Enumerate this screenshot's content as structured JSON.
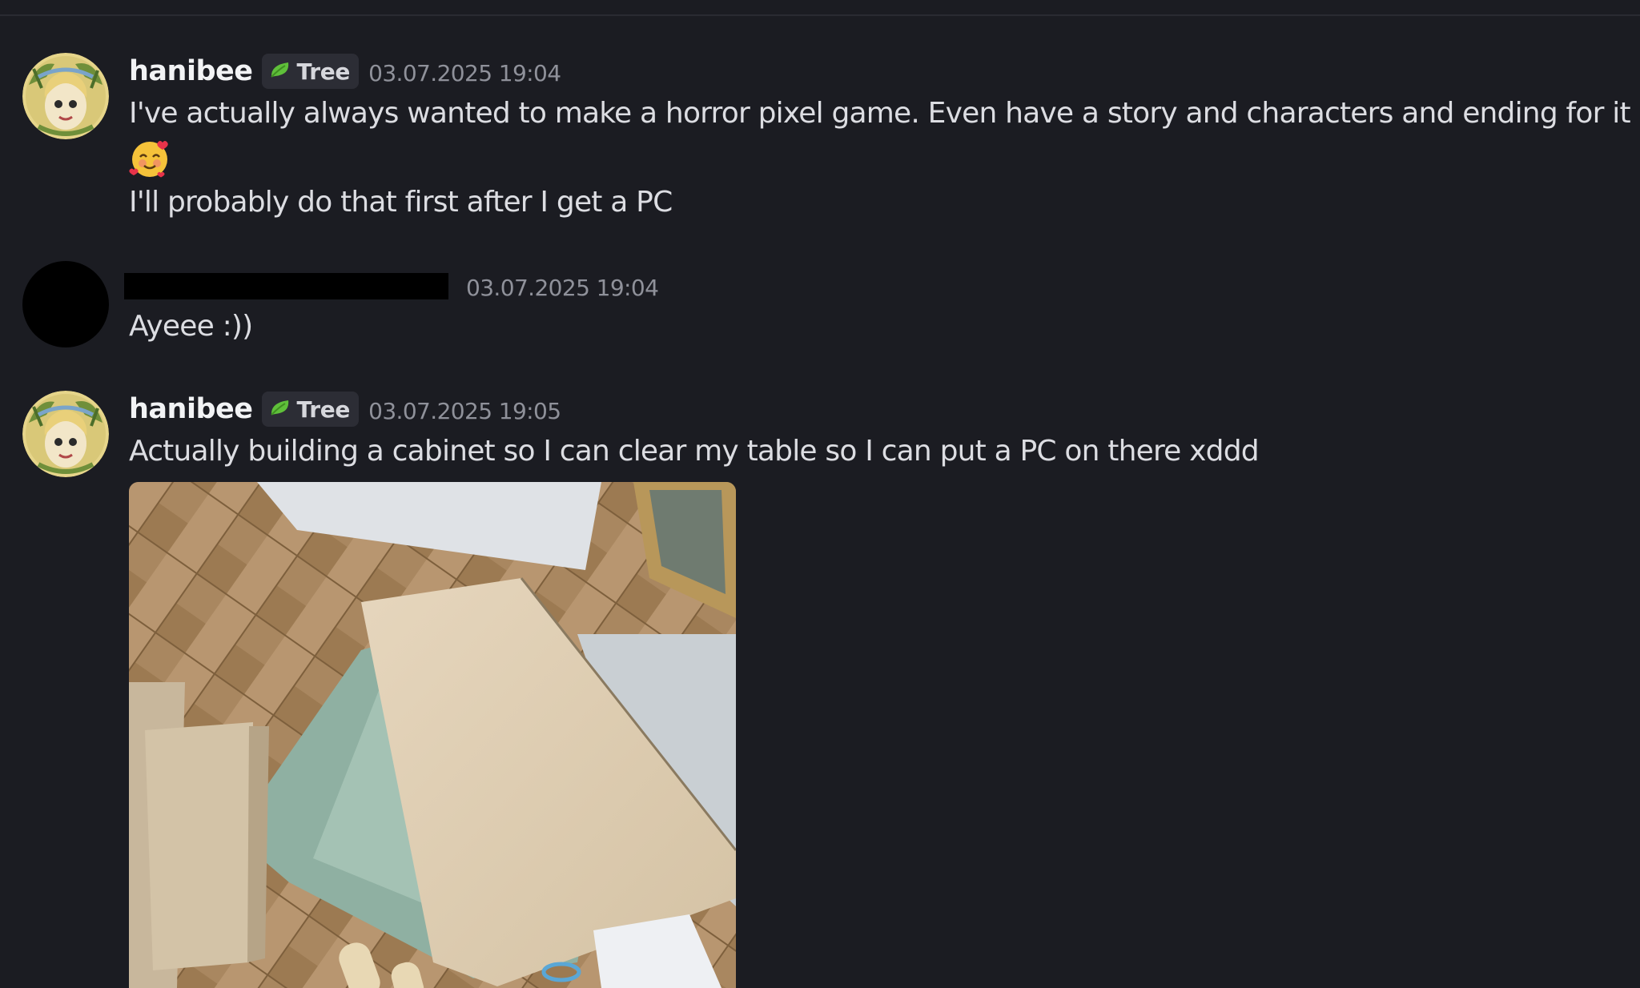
{
  "messages": [
    {
      "author": "hanibee",
      "role_tag": "Tree",
      "timestamp": "03.07.2025 19:04",
      "lines": [
        "I've actually always wanted to make a horror pixel game. Even have a story and characters and ending for it",
        "I'll probably do that first after I get a PC"
      ],
      "emoji": "smiling-face-with-hearts"
    },
    {
      "author": "",
      "author_redacted": true,
      "timestamp": "03.07.2025 19:04",
      "lines": [
        "Ayeee :))"
      ]
    },
    {
      "author": "hanibee",
      "role_tag": "Tree",
      "timestamp": "03.07.2025 19:05",
      "lines": [
        "Actually building a cabinet so I can clear my table so I can put a PC on there xddd"
      ],
      "attachment": "photo-of-cabinet-panels-on-parquet-floor"
    }
  ],
  "colors": {
    "background": "#1b1c22",
    "username": "#f2f3f5",
    "message_text": "#dcdde2",
    "timestamp": "#8f919a",
    "role_tag_bg": "#2c2d35",
    "leaf_icon": "#5fc03a"
  }
}
